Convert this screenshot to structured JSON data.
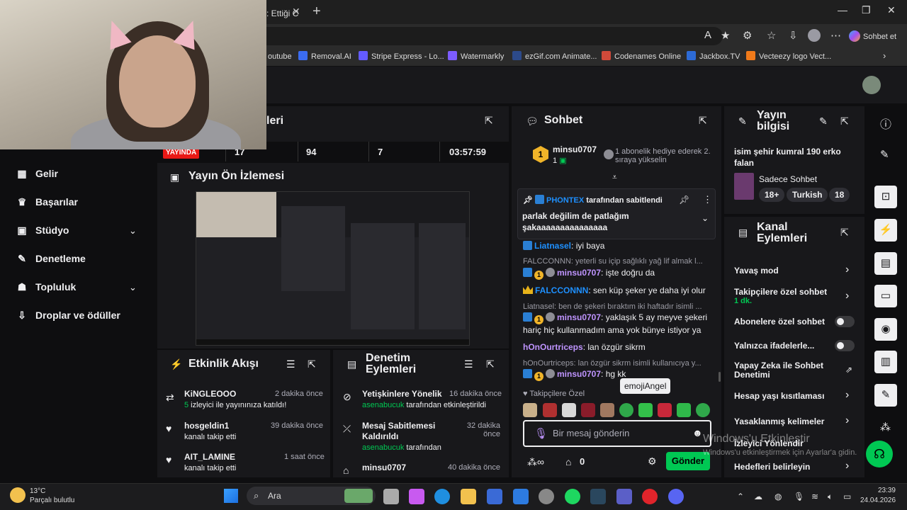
{
  "browser": {
    "tab_title": ": Ettiği C",
    "copilot_label": "Sohbet et",
    "bookmarks": [
      {
        "label": "outube",
        "color": "#ff0000"
      },
      {
        "label": "Removal.AI",
        "color": "#3b6cf0"
      },
      {
        "label": "Stripe Express - Lo...",
        "color": "#635bff"
      },
      {
        "label": "Watermarkly",
        "color": "#7c5cff"
      },
      {
        "label": "ezGif.com Animate...",
        "color": "#2c4a8a"
      },
      {
        "label": "Codenames Online",
        "color": "#d04a3a"
      },
      {
        "label": "Jackbox.TV",
        "color": "#2d6bd6"
      },
      {
        "label": "Vecteezy logo Vect...",
        "color": "#f07a1a"
      }
    ]
  },
  "left_nav": {
    "partial_top_title": "leri",
    "items": [
      {
        "label": "Gelir",
        "icon": "gelir-icon"
      },
      {
        "label": "Başarılar",
        "icon": "trophy-icon"
      },
      {
        "label": "Stüdyo",
        "icon": "studio-icon"
      },
      {
        "label": "Denetleme",
        "icon": "wrench-icon"
      },
      {
        "label": "Topluluk",
        "icon": "community-icon"
      },
      {
        "label": "Droplar ve ödüller",
        "icon": "drops-icon"
      }
    ]
  },
  "stats": {
    "live": "YAYINDA",
    "viewers": "17",
    "followers": "94",
    "subs": "7",
    "uptime": "03:57:59"
  },
  "preview": {
    "title": "Yayın Ön İzlemesi"
  },
  "activity": {
    "title": "Etkinlik Akışı",
    "items": [
      {
        "user": "KiNGLEOOO",
        "time": "2 dakika önce",
        "count": "5",
        "detail": " izleyici ile yayınınıza katıldı!"
      },
      {
        "user": "hosgeldin1",
        "time": "39 dakika önce",
        "detail": "kanalı takip etti"
      },
      {
        "user": "AIT_LAMINE",
        "time": "1 saat önce",
        "detail": "kanalı takip etti"
      }
    ]
  },
  "mod_actions": {
    "title": "Denetim Eylemleri",
    "items": [
      {
        "action": "Yetişkinlere Yönelik",
        "time": "16 dakika önce",
        "by": "asenabucuk",
        "detail": " tarafından etkinleştirildi"
      },
      {
        "action": "Mesaj Sabitlemesi Kaldırıldı",
        "time": "32 dakika önce",
        "by": "asenabucuk",
        "detail": " tarafından"
      },
      {
        "action": "minsu0707",
        "time": "40 dakika önce"
      }
    ]
  },
  "chat": {
    "title": "Sohbet",
    "gift_user": "minsu0707",
    "gift_count": "1",
    "gift_text": "1 abonelik hediye ederek 2. sıraya yükselin",
    "pinned_by": "PHONTEX",
    "pinned_suffix": " tarafından sabitlendi",
    "pinned_msg": "parlak değilim de patlağım şakaaaaaaaaaaaaaaa",
    "messages": [
      {
        "user": "Liatnasel",
        "text": ": iyi baya",
        "color": "#1e90ff",
        "badges": [
          "pr"
        ]
      },
      {
        "muted": "FALCCONNN: yeterli su içip sağlıklı yağ lif almak l..."
      },
      {
        "user": "minsu0707",
        "text": ": işte doğru da",
        "color": "#bf94ff",
        "badges": [
          "pr",
          "gold",
          "grey"
        ]
      },
      {
        "user": "FALCCONNN",
        "text": ": sen küp şeker ye daha iyi olur",
        "color": "#1e90ff",
        "badges": [
          "crown"
        ]
      },
      {
        "muted": "Liatnasel: ben de şekeri bıraktım iki haftadır isimli ..."
      },
      {
        "user": "minsu0707",
        "text": ": yaklaşık 5 ay meyve şekeri hariç hiç kullanmadım ama yok bünye istiyor ya",
        "color": "#bf94ff",
        "badges": [
          "pr",
          "gold",
          "grey"
        ]
      },
      {
        "user": "hOnOurtriceps",
        "text": ": lan özgür sikrm",
        "color": "#bf94ff",
        "badges": []
      },
      {
        "muted": "hOnOurtriceps: lan özgür sikrm isimli kullanıcıya y..."
      },
      {
        "user": "minsu0707",
        "text": ": hg kk",
        "color": "#bf94ff",
        "badges": [
          "pr",
          "gold",
          "grey"
        ]
      }
    ],
    "followers_only": "Takipçilere Özel",
    "emote_tooltip": "emojiAngel",
    "input_placeholder": "Bir mesaj gönderin",
    "points": "0",
    "send_label": "Gönder"
  },
  "stream_info": {
    "title": "Yayın bilgisi",
    "stream_title": "isim şehir kumral 190 erko falan",
    "category": "Sadece Sohbet",
    "tags": [
      "18+",
      "Turkish",
      "18"
    ]
  },
  "channel_actions": {
    "title": "Kanal Eylemleri",
    "items": [
      {
        "label": "Yavaş mod",
        "type": "chevron"
      },
      {
        "label": "Takipçilere özel sohbet",
        "sub": "1 dk.",
        "type": "chevron"
      },
      {
        "label": "Abonelere özel sohbet",
        "type": "toggle"
      },
      {
        "label": "Yalnızca ifadelerle...",
        "type": "toggle"
      },
      {
        "label": "Yapay Zeka ile Sohbet Denetimi",
        "type": "external"
      },
      {
        "label": "Hesap yaşı kısıtlaması",
        "type": "chevron"
      },
      {
        "label": "Yasaklanmış kelimeler",
        "type": "chevron"
      },
      {
        "label": "İzleyici Yönlendir",
        "type": "none"
      },
      {
        "label": "Hedefleri belirleyin",
        "type": "chevron"
      }
    ]
  },
  "watermark": {
    "line1": "Windows'u Etkinleştir",
    "line2": "Windows'u etkinleştirmek için Ayarlar'a gidin."
  },
  "taskbar": {
    "weather_temp": "13°C",
    "weather_desc": "Parçalı bulutlu",
    "search_label": "Ara",
    "time": "23:39",
    "date": "24.04.2026"
  }
}
